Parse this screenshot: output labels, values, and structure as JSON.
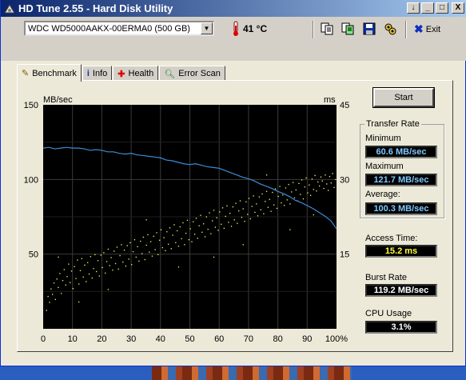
{
  "window": {
    "title": "HD Tune 2.55 - Hard Disk Utility"
  },
  "titlebar_buttons": {
    "help": "↓",
    "minimize": "_",
    "maximize": "□",
    "close": "X"
  },
  "toolbar": {
    "drive": "WDC WD5000AAKX-00ERMA0 (500 GB)",
    "temperature": "41 °C",
    "exit_label": "Exit",
    "icons": [
      "copy-text-icon",
      "copy-screenshot-icon",
      "save-icon",
      "options-icon"
    ]
  },
  "tabs": [
    {
      "label": "Benchmark",
      "icon": "benchmark-icon",
      "active": true
    },
    {
      "label": "Info",
      "icon": "info-icon"
    },
    {
      "label": "Health",
      "icon": "health-icon"
    },
    {
      "label": "Error Scan",
      "icon": "error-scan-icon"
    }
  ],
  "start_label": "Start",
  "transfer_rate": {
    "title": "Transfer Rate",
    "minimum_label": "Minimum",
    "minimum": "60.6 MB/sec",
    "maximum_label": "Maximum",
    "maximum": "121.7 MB/sec",
    "average_label": "Average:",
    "average": "100.3 MB/sec"
  },
  "access_time": {
    "label": "Access Time:",
    "value": "15.2 ms"
  },
  "burst_rate": {
    "label": "Burst Rate",
    "value": "119.2 MB/sec"
  },
  "cpu_usage": {
    "label": "CPU Usage",
    "value": "3.1%"
  },
  "colors": {
    "transfer_line": "#3c8cd8",
    "access_dots": "#ffff60",
    "plot_bg": "#000000",
    "grid": "#3a3a3a"
  },
  "chart_data": {
    "type": "line",
    "ylabel": "MB/sec",
    "y2label": "ms",
    "xlim": [
      0,
      100
    ],
    "ylim": [
      0,
      150
    ],
    "y2lim": [
      0,
      45
    ],
    "x_ticks": [
      "0",
      "10",
      "20",
      "30",
      "40",
      "50",
      "60",
      "70",
      "80",
      "90",
      "100%"
    ],
    "y_ticks": [
      "150",
      "100",
      "50"
    ],
    "y2_ticks": [
      "45",
      "30",
      "15"
    ],
    "grid": true,
    "series": [
      {
        "kind": "transfer_rate",
        "x": [
          0,
          2,
          4,
          6,
          8,
          10,
          12,
          14,
          16,
          18,
          20,
          22,
          24,
          26,
          28,
          30,
          32,
          34,
          36,
          38,
          40,
          42,
          44,
          46,
          48,
          50,
          52,
          54,
          56,
          58,
          60,
          62,
          64,
          66,
          68,
          70,
          72,
          74,
          76,
          78,
          80,
          82,
          84,
          86,
          88,
          90,
          92,
          94,
          96,
          98,
          100
        ],
        "y": [
          121,
          121.5,
          120.5,
          121,
          121.5,
          121,
          121,
          120.5,
          119.5,
          120,
          119.5,
          118.5,
          118.5,
          117.5,
          117,
          117.5,
          116.5,
          116,
          115.5,
          115,
          114.5,
          113,
          112.5,
          111.5,
          110.5,
          110,
          110.5,
          109.5,
          108.5,
          108,
          107.5,
          106,
          104.5,
          103,
          101.5,
          100.5,
          99,
          97,
          95.5,
          94,
          92,
          90.5,
          88.5,
          86,
          84.5,
          82.5,
          80.5,
          78,
          75.5,
          72.5,
          67
        ]
      },
      {
        "kind": "access_time_ms",
        "points": [
          [
            1.0,
            3.8
          ],
          [
            1.5,
            6.6
          ],
          [
            2.0,
            5.4
          ],
          [
            2.5,
            8.1
          ],
          [
            3.0,
            7.0
          ],
          [
            3.5,
            9.3
          ],
          [
            4.0,
            6.0
          ],
          [
            4.5,
            10.1
          ],
          [
            5.0,
            8.4
          ],
          [
            5.5,
            11.2
          ],
          [
            6.0,
            7.2
          ],
          [
            6.5,
            9.8
          ],
          [
            7.0,
            12.0
          ],
          [
            7.5,
            8.9
          ],
          [
            8.0,
            10.6
          ],
          [
            8.5,
            13.1
          ],
          [
            9.0,
            9.4
          ],
          [
            9.5,
            11.7
          ],
          [
            10.0,
            8.2
          ],
          [
            10.5,
            12.6
          ],
          [
            11.0,
            10.2
          ],
          [
            11.5,
            13.9
          ],
          [
            12.0,
            9.1
          ],
          [
            12.5,
            11.8
          ],
          [
            13.0,
            14.2
          ],
          [
            13.5,
            10.5
          ],
          [
            14.0,
            12.9
          ],
          [
            14.5,
            9.6
          ],
          [
            15.0,
            13.4
          ],
          [
            15.5,
            11.1
          ],
          [
            16.0,
            14.6
          ],
          [
            16.5,
            10.3
          ],
          [
            17.0,
            12.2
          ],
          [
            17.5,
            15.0
          ],
          [
            18.0,
            11.6
          ],
          [
            18.5,
            13.8
          ],
          [
            19.0,
            10.7
          ],
          [
            19.5,
            14.9
          ],
          [
            20.0,
            12.4
          ],
          [
            20.5,
            15.4
          ],
          [
            21.0,
            11.3
          ],
          [
            21.5,
            13.6
          ],
          [
            22.0,
            16.1
          ],
          [
            22.5,
            12.8
          ],
          [
            23.0,
            14.4
          ],
          [
            23.5,
            11.9
          ],
          [
            24.0,
            15.7
          ],
          [
            24.5,
            13.2
          ],
          [
            25.0,
            16.5
          ],
          [
            25.5,
            12.1
          ],
          [
            26.0,
            14.8
          ],
          [
            26.5,
            17.0
          ],
          [
            27.0,
            13.5
          ],
          [
            27.5,
            15.9
          ],
          [
            28.0,
            12.7
          ],
          [
            28.5,
            16.8
          ],
          [
            29.0,
            14.1
          ],
          [
            29.5,
            17.4
          ],
          [
            30.0,
            13.0
          ],
          [
            30.5,
            15.6
          ],
          [
            31.0,
            18.0
          ],
          [
            31.5,
            14.5
          ],
          [
            32.0,
            16.6
          ],
          [
            32.5,
            13.7
          ],
          [
            33.0,
            17.7
          ],
          [
            33.5,
            15.2
          ],
          [
            34.0,
            18.5
          ],
          [
            34.5,
            14.0
          ],
          [
            35.0,
            16.9
          ],
          [
            35.5,
            19.0
          ],
          [
            36.0,
            15.5
          ],
          [
            36.5,
            17.6
          ],
          [
            37.0,
            14.7
          ],
          [
            37.5,
            18.7
          ],
          [
            38.0,
            16.0
          ],
          [
            38.5,
            19.4
          ],
          [
            39.0,
            15.0
          ],
          [
            39.5,
            17.9
          ],
          [
            40.0,
            20.0
          ],
          [
            40.5,
            16.4
          ],
          [
            41.0,
            18.4
          ],
          [
            41.5,
            15.8
          ],
          [
            42.0,
            19.6
          ],
          [
            42.5,
            17.1
          ],
          [
            43.0,
            20.4
          ],
          [
            43.5,
            16.2
          ],
          [
            44.0,
            18.9
          ],
          [
            44.5,
            21.0
          ],
          [
            45.0,
            17.4
          ],
          [
            45.5,
            19.8
          ],
          [
            46.0,
            16.7
          ],
          [
            46.5,
            20.6
          ],
          [
            47.0,
            18.2
          ],
          [
            47.5,
            21.4
          ],
          [
            48.0,
            17.0
          ],
          [
            48.5,
            19.3
          ],
          [
            49.0,
            21.9
          ],
          [
            49.5,
            18.0
          ],
          [
            50.0,
            20.2
          ],
          [
            50.5,
            17.6
          ],
          [
            51.0,
            21.6
          ],
          [
            51.5,
            19.1
          ],
          [
            52.0,
            22.3
          ],
          [
            52.5,
            18.3
          ],
          [
            53.0,
            20.8
          ],
          [
            53.5,
            22.9
          ],
          [
            54.0,
            19.5
          ],
          [
            54.5,
            21.2
          ],
          [
            55.0,
            18.6
          ],
          [
            55.5,
            22.6
          ],
          [
            56.0,
            20.1
          ],
          [
            56.5,
            23.4
          ],
          [
            57.0,
            19.2
          ],
          [
            57.5,
            21.8
          ],
          [
            58.0,
            23.9
          ],
          [
            58.5,
            20.5
          ],
          [
            59.0,
            22.4
          ],
          [
            59.5,
            19.9
          ],
          [
            60.0,
            23.6
          ],
          [
            60.5,
            21.1
          ],
          [
            61.0,
            24.4
          ],
          [
            61.5,
            20.3
          ],
          [
            62.0,
            22.7
          ],
          [
            62.5,
            24.8
          ],
          [
            63.0,
            21.5
          ],
          [
            63.5,
            23.3
          ],
          [
            64.0,
            20.7
          ],
          [
            64.5,
            24.6
          ],
          [
            65.0,
            22.0
          ],
          [
            65.5,
            25.3
          ],
          [
            66.0,
            21.3
          ],
          [
            66.5,
            23.8
          ],
          [
            67.0,
            25.8
          ],
          [
            67.5,
            22.5
          ],
          [
            68.0,
            24.2
          ],
          [
            68.5,
            21.7
          ],
          [
            69.0,
            25.6
          ],
          [
            69.5,
            23.1
          ],
          [
            70.0,
            26.3
          ],
          [
            70.5,
            22.2
          ],
          [
            71.0,
            24.7
          ],
          [
            71.5,
            26.8
          ],
          [
            72.0,
            23.5
          ],
          [
            72.5,
            25.2
          ],
          [
            73.0,
            22.8
          ],
          [
            73.5,
            26.6
          ],
          [
            74.0,
            24.0
          ],
          [
            74.5,
            27.2
          ],
          [
            75.0,
            23.2
          ],
          [
            75.5,
            25.7
          ],
          [
            76.0,
            27.7
          ],
          [
            76.5,
            24.5
          ],
          [
            77.0,
            26.1
          ],
          [
            77.5,
            23.7
          ],
          [
            78.0,
            27.5
          ],
          [
            78.5,
            25.0
          ],
          [
            79.0,
            28.2
          ],
          [
            79.5,
            24.3
          ],
          [
            80.0,
            26.7
          ],
          [
            80.5,
            28.7
          ],
          [
            81.0,
            25.4
          ],
          [
            81.5,
            27.0
          ],
          [
            82.0,
            24.9
          ],
          [
            82.5,
            28.4
          ],
          [
            83.0,
            26.0
          ],
          [
            83.5,
            29.1
          ],
          [
            84.0,
            25.2
          ],
          [
            84.5,
            27.6
          ],
          [
            85.0,
            29.5
          ],
          [
            85.5,
            26.4
          ],
          [
            86.0,
            28.0
          ],
          [
            86.5,
            25.8
          ],
          [
            87.0,
            29.3
          ],
          [
            87.5,
            27.1
          ],
          [
            88.0,
            30.0
          ],
          [
            88.5,
            26.2
          ],
          [
            89.0,
            28.6
          ],
          [
            89.5,
            30.4
          ],
          [
            90.0,
            27.4
          ],
          [
            90.5,
            29.0
          ],
          [
            91.0,
            26.9
          ],
          [
            91.5,
            30.2
          ],
          [
            92.0,
            28.1
          ],
          [
            92.5,
            30.9
          ],
          [
            93.0,
            27.8
          ],
          [
            93.5,
            29.6
          ],
          [
            94.0,
            28.8
          ],
          [
            94.5,
            30.6
          ],
          [
            95.0,
            29.8
          ],
          [
            95.5,
            28.3
          ],
          [
            96.0,
            31.0
          ],
          [
            96.5,
            29.2
          ],
          [
            97.0,
            27.9
          ],
          [
            97.5,
            30.7
          ],
          [
            98.0,
            29.4
          ],
          [
            98.5,
            31.3
          ],
          [
            99.0,
            28.5
          ],
          [
            99.5,
            30.1
          ],
          [
            5.0,
            14.5
          ],
          [
            12.0,
            5.5
          ],
          [
            22.0,
            8.0
          ],
          [
            35.0,
            22.0
          ],
          [
            46.0,
            12.5
          ],
          [
            58.0,
            14.5
          ],
          [
            68.0,
            17.0
          ],
          [
            76.0,
            31.0
          ],
          [
            84.0,
            20.0
          ],
          [
            92.0,
            23.0
          ]
        ]
      }
    ]
  }
}
